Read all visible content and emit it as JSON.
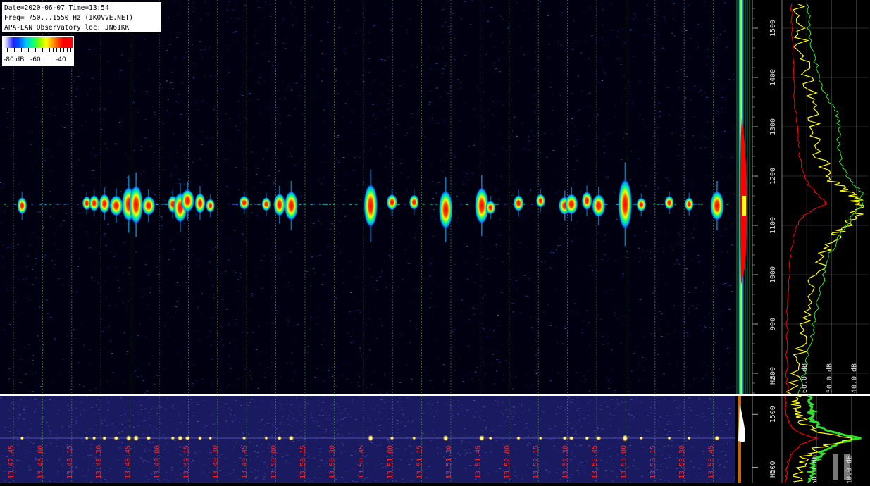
{
  "header": {
    "line1": "Date=2020-06-07 Time=13:54",
    "line2": "Freq= 750...1550 Hz (IK0VVE.NET)",
    "line3": "APA-LAN Observatory loc: JN61KK"
  },
  "colorbar": {
    "labels": [
      "-80 dB",
      "-60",
      "-40"
    ]
  },
  "colors": {
    "background": "#000000",
    "grid_line": "#3c7a3c",
    "time_label": "#ff2020",
    "spectrum_max": "#ffff00",
    "spectrum_avg": "#ff0000",
    "spectrum_green": "#30e030",
    "waterfall_noise": "#1a1a6e"
  },
  "chart_data": [
    {
      "type": "heatmap",
      "name": "waterfall",
      "x_unit": "time",
      "y_unit": "Hz",
      "ylim": [
        750,
        1550
      ],
      "y_ticks": [
        800,
        900,
        1000,
        1100,
        1200,
        1300,
        1400,
        1500
      ],
      "y_axis_unit_label": "Hz",
      "x_ticks": [
        "13.47.45",
        "13.48.00",
        "13.48.15",
        "13.48.30",
        "13.48.45",
        "13.49.00",
        "13.49.15",
        "13.49.30",
        "13.49.45",
        "13.50.00",
        "13.50.15",
        "13.50.30",
        "13.50.45",
        "13.51.00",
        "13.51.15",
        "13.51.30",
        "13.51.45",
        "13.52.00",
        "13.52.15",
        "13.52.30",
        "13.52.45",
        "13.53.00",
        "13.53.15",
        "13.53.30",
        "13.53.45"
      ],
      "grid": true,
      "carrier_hz": 1143,
      "echoes": [
        {
          "t": 0.03,
          "f": 1140,
          "s": 0.35,
          "i": 0.4
        },
        {
          "t": 0.118,
          "f": 1145,
          "s": 0.2,
          "i": 0.3
        },
        {
          "t": 0.128,
          "f": 1145,
          "s": 0.3,
          "i": 0.45
        },
        {
          "t": 0.142,
          "f": 1144,
          "s": 0.45,
          "i": 0.6
        },
        {
          "t": 0.158,
          "f": 1140,
          "s": 0.5,
          "i": 0.95
        },
        {
          "t": 0.175,
          "f": 1143,
          "s": 1.1,
          "i": 1.0
        },
        {
          "t": 0.185,
          "f": 1142,
          "s": 1.3,
          "i": 1.0
        },
        {
          "t": 0.202,
          "f": 1140,
          "s": 0.45,
          "i": 0.9
        },
        {
          "t": 0.235,
          "f": 1143,
          "s": 0.35,
          "i": 0.5
        },
        {
          "t": 0.245,
          "f": 1136,
          "s": 0.9,
          "i": 1.0
        },
        {
          "t": 0.255,
          "f": 1150,
          "s": 0.6,
          "i": 0.95
        },
        {
          "t": 0.272,
          "f": 1145,
          "s": 0.5,
          "i": 0.55
        },
        {
          "t": 0.286,
          "f": 1140,
          "s": 0.2,
          "i": 0.3
        },
        {
          "t": 0.332,
          "f": 1146,
          "s": 0.2,
          "i": 0.5
        },
        {
          "t": 0.362,
          "f": 1143,
          "s": 0.2,
          "i": 0.3
        },
        {
          "t": 0.38,
          "f": 1142,
          "s": 0.6,
          "i": 0.7
        },
        {
          "t": 0.396,
          "f": 1140,
          "s": 0.9,
          "i": 0.95
        },
        {
          "t": 0.504,
          "f": 1140,
          "s": 1.5,
          "i": 1.0
        },
        {
          "t": 0.533,
          "f": 1147,
          "s": 0.3,
          "i": 0.55
        },
        {
          "t": 0.563,
          "f": 1147,
          "s": 0.25,
          "i": 0.4
        },
        {
          "t": 0.606,
          "f": 1132,
          "s": 1.3,
          "i": 1.0
        },
        {
          "t": 0.655,
          "f": 1140,
          "s": 1.2,
          "i": 1.0
        },
        {
          "t": 0.667,
          "f": 1136,
          "s": 0.2,
          "i": 0.45
        },
        {
          "t": 0.705,
          "f": 1145,
          "s": 0.3,
          "i": 0.5
        },
        {
          "t": 0.735,
          "f": 1150,
          "s": 0.2,
          "i": 0.3
        },
        {
          "t": 0.768,
          "f": 1140,
          "s": 0.4,
          "i": 0.8
        },
        {
          "t": 0.777,
          "f": 1143,
          "s": 0.5,
          "i": 0.85
        },
        {
          "t": 0.798,
          "f": 1150,
          "s": 0.4,
          "i": 0.5
        },
        {
          "t": 0.814,
          "f": 1140,
          "s": 0.6,
          "i": 0.95
        },
        {
          "t": 0.85,
          "f": 1143,
          "s": 1.8,
          "i": 1.0
        },
        {
          "t": 0.872,
          "f": 1142,
          "s": 0.2,
          "i": 0.4
        },
        {
          "t": 0.91,
          "f": 1146,
          "s": 0.2,
          "i": 0.35
        },
        {
          "t": 0.937,
          "f": 1143,
          "s": 0.2,
          "i": 0.3
        },
        {
          "t": 0.975,
          "f": 1140,
          "s": 0.9,
          "i": 0.95
        }
      ]
    },
    {
      "type": "line",
      "name": "spectrum",
      "x_ticks": [
        "-60.0 dB",
        "-50.0 dB",
        "-40.0 dB"
      ],
      "xlim": [
        -70,
        -35
      ],
      "ylim": [
        750,
        1550
      ],
      "series": [
        {
          "color_key": "spectrum_max",
          "points": [
            [
              750,
              -66
            ],
            [
              800,
              -64
            ],
            [
              850,
              -62
            ],
            [
              900,
              -60
            ],
            [
              950,
              -58
            ],
            [
              1000,
              -56
            ],
            [
              1050,
              -53
            ],
            [
              1080,
              -48
            ],
            [
              1100,
              -43
            ],
            [
              1120,
              -40
            ],
            [
              1143,
              -39
            ],
            [
              1160,
              -41
            ],
            [
              1180,
              -47
            ],
            [
              1200,
              -52
            ],
            [
              1250,
              -55
            ],
            [
              1300,
              -56
            ],
            [
              1350,
              -58
            ],
            [
              1400,
              -60
            ],
            [
              1450,
              -62
            ],
            [
              1500,
              -63
            ],
            [
              1550,
              -64
            ]
          ]
        },
        {
          "color_key": "spectrum_green",
          "points": [
            [
              750,
              -63
            ],
            [
              800,
              -61
            ],
            [
              850,
              -59
            ],
            [
              900,
              -57
            ],
            [
              950,
              -55
            ],
            [
              1000,
              -53
            ],
            [
              1050,
              -50
            ],
            [
              1100,
              -44
            ],
            [
              1143,
              -38
            ],
            [
              1170,
              -38
            ],
            [
              1190,
              -42
            ],
            [
              1220,
              -46
            ],
            [
              1260,
              -47
            ],
            [
              1300,
              -47
            ],
            [
              1330,
              -48
            ],
            [
              1360,
              -52
            ],
            [
              1400,
              -55
            ],
            [
              1450,
              -57
            ],
            [
              1500,
              -59
            ],
            [
              1550,
              -60
            ]
          ]
        },
        {
          "color_key": "spectrum_avg",
          "points": [
            [
              750,
              -68
            ],
            [
              800,
              -68
            ],
            [
              900,
              -68
            ],
            [
              1000,
              -67
            ],
            [
              1050,
              -66.5
            ],
            [
              1100,
              -64
            ],
            [
              1120,
              -61
            ],
            [
              1135,
              -56
            ],
            [
              1143,
              -52
            ],
            [
              1150,
              -53
            ],
            [
              1160,
              -55
            ],
            [
              1180,
              -59
            ],
            [
              1200,
              -61
            ],
            [
              1250,
              -63
            ],
            [
              1300,
              -64
            ],
            [
              1400,
              -65.5
            ],
            [
              1500,
              -66
            ],
            [
              1550,
              -66
            ]
          ]
        }
      ]
    },
    {
      "type": "heatmap",
      "name": "wide-waterfall",
      "y_ticks": [
        500,
        1500
      ],
      "y_axis_unit_label": "Hz",
      "x_ticks": [
        "-50.0 dB",
        "-40.0 dB"
      ],
      "xlim": [
        -60,
        -35
      ]
    }
  ]
}
